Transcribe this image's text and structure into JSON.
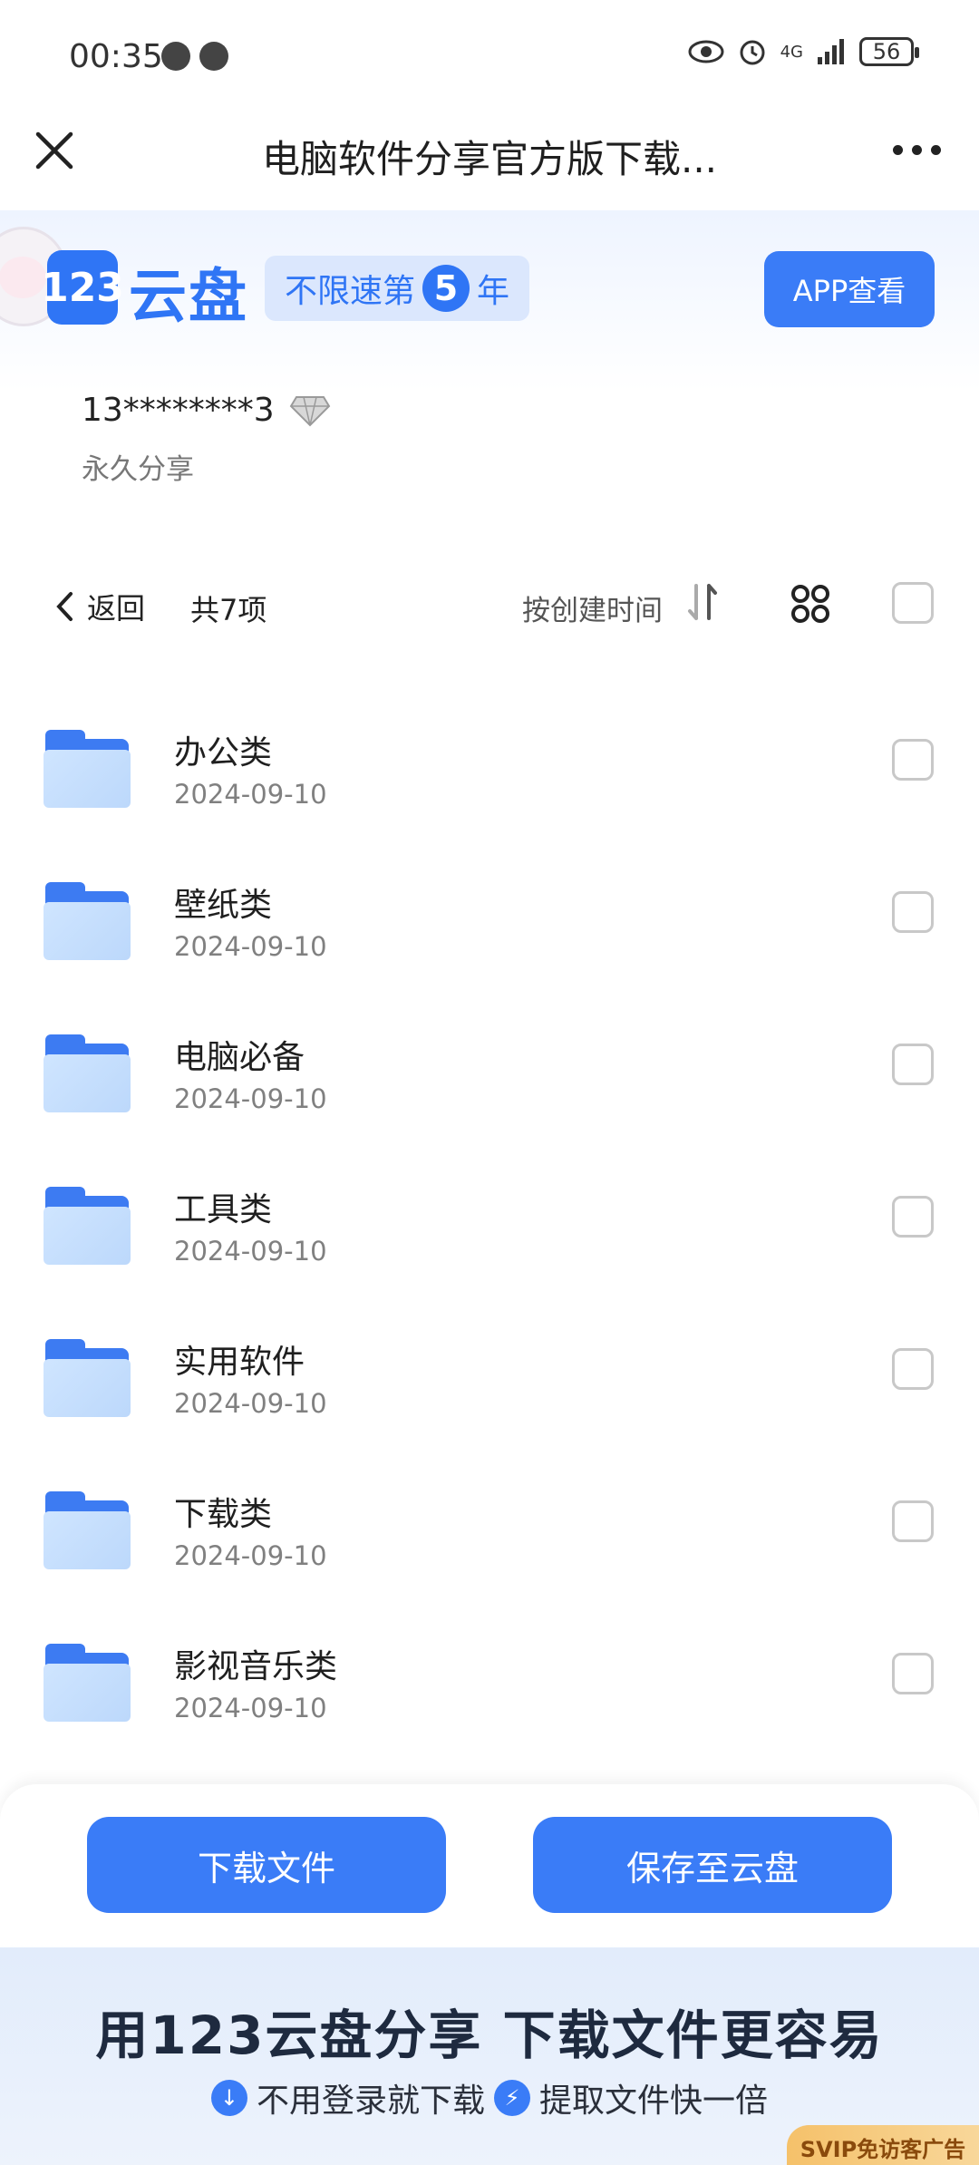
{
  "status_bar": {
    "time": "00:35",
    "network": "4G",
    "battery": "56"
  },
  "header": {
    "title": "电脑软件分享官方版下载..."
  },
  "brand": {
    "logo_number": "123",
    "logo_text": "云盘",
    "speed_prefix": "不限速第",
    "speed_year": "5",
    "speed_suffix": "年",
    "app_button": "APP查看",
    "accent_color": "#2f75f5"
  },
  "share": {
    "sharer": "13********3",
    "type": "永久分享"
  },
  "toolbar": {
    "back_label": "返回",
    "count_label": "共7项",
    "sort_label": "按创建时间"
  },
  "files": [
    {
      "name": "办公类",
      "date": "2024-09-10"
    },
    {
      "name": "壁纸类",
      "date": "2024-09-10"
    },
    {
      "name": "电脑必备",
      "date": "2024-09-10"
    },
    {
      "name": "工具类",
      "date": "2024-09-10"
    },
    {
      "name": "实用软件",
      "date": "2024-09-10"
    },
    {
      "name": "下载类",
      "date": "2024-09-10"
    },
    {
      "name": "影视音乐类",
      "date": "2024-09-10"
    }
  ],
  "actions": {
    "download": "下载文件",
    "save": "保存至云盘"
  },
  "footer": {
    "headline": "用123云盘分享  下载文件更容易",
    "feature_1": "不用登录就下载",
    "feature_2": "提取文件快一倍",
    "svip_tag": "SVIP免访客广告"
  }
}
